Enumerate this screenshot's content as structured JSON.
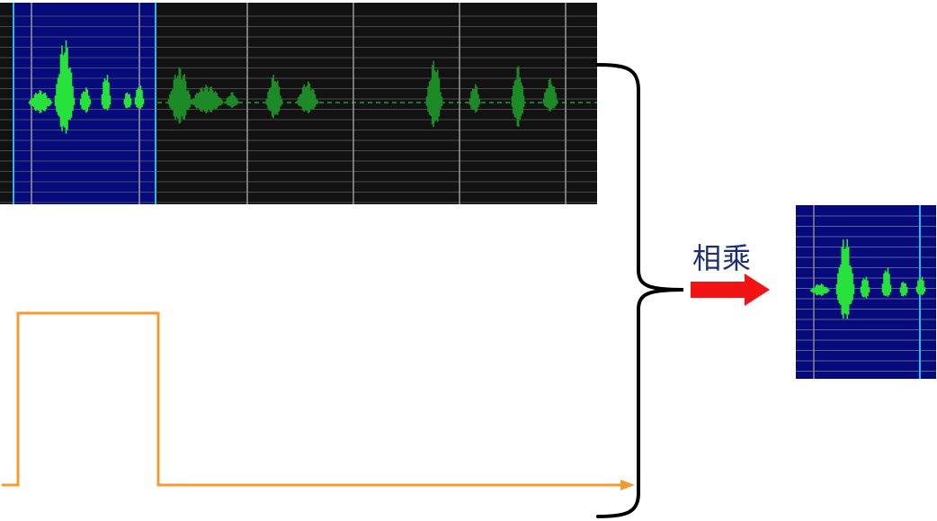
{
  "diagram": {
    "operation_label": "相乘"
  },
  "colors": {
    "waveform_bg": "#121212",
    "window_bg": "#060a7a",
    "window_edge": "#2fb6e6",
    "wave_green": "#27e23a",
    "wave_dark_green": "#1c8a26",
    "grid_line": "#8a8a8a",
    "rect_window": "#f59b33",
    "arrow": "#f21414",
    "label_color": "#1c2f70",
    "brace": "#000000"
  },
  "icons": {
    "arrow": "right-arrow-icon",
    "brace": "right-curly-brace"
  }
}
